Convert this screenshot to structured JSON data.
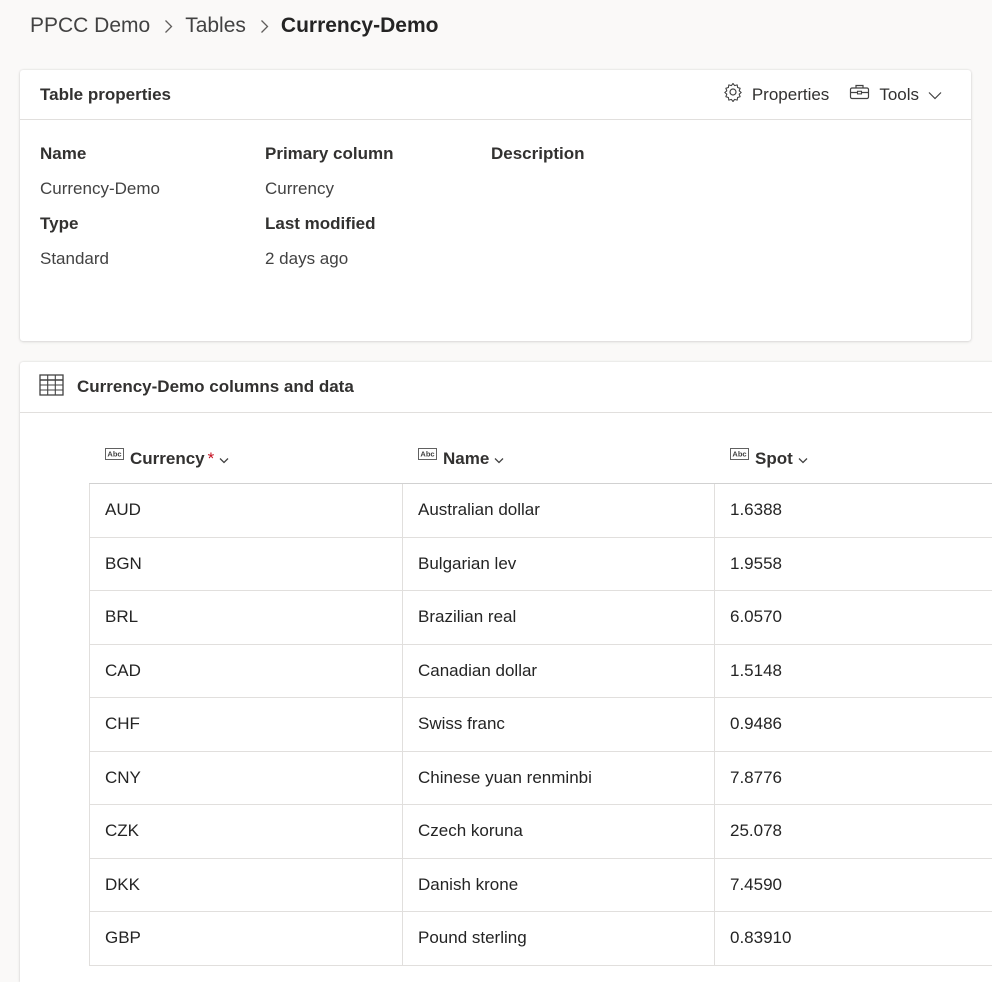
{
  "breadcrumb": {
    "items": [
      "PPCC Demo",
      "Tables"
    ],
    "current": "Currency-Demo"
  },
  "properties_card": {
    "title": "Table properties",
    "properties_label": "Properties",
    "tools_label": "Tools",
    "fields": {
      "name_label": "Name",
      "name_value": "Currency-Demo",
      "type_label": "Type",
      "type_value": "Standard",
      "primary_label": "Primary column",
      "primary_value": "Currency",
      "modified_label": "Last modified",
      "modified_value": "2 days ago",
      "description_label": "Description"
    }
  },
  "data_card": {
    "title": "Currency-Demo columns and data",
    "columns": [
      {
        "label": "Currency",
        "required_mark": "*"
      },
      {
        "label": "Name"
      },
      {
        "label": "Spot"
      }
    ],
    "rows": [
      {
        "currency": "AUD",
        "name": "Australian dollar",
        "spot": "1.6388"
      },
      {
        "currency": "BGN",
        "name": "Bulgarian lev",
        "spot": "1.9558"
      },
      {
        "currency": "BRL",
        "name": "Brazilian real",
        "spot": "6.0570"
      },
      {
        "currency": "CAD",
        "name": "Canadian dollar",
        "spot": "1.5148"
      },
      {
        "currency": "CHF",
        "name": "Swiss franc",
        "spot": "0.9486"
      },
      {
        "currency": "CNY",
        "name": "Chinese yuan renminbi",
        "spot": "7.8776"
      },
      {
        "currency": "CZK",
        "name": "Czech koruna",
        "spot": "25.078"
      },
      {
        "currency": "DKK",
        "name": "Danish krone",
        "spot": "7.4590"
      },
      {
        "currency": "GBP",
        "name": "Pound sterling",
        "spot": "0.83910"
      }
    ]
  },
  "icons": {
    "breadcrumb_separator": "chevron-right-icon",
    "properties": "gear-icon",
    "tools": "toolbox-icon",
    "tools_dropdown": "chevron-down-icon",
    "table": "table-grid-icon",
    "column_type": "text-type-icon",
    "column_dropdown": "chevron-down-icon"
  },
  "colors": {
    "required": "#c50f1f",
    "background": "#faf9f8",
    "card": "#ffffff"
  }
}
